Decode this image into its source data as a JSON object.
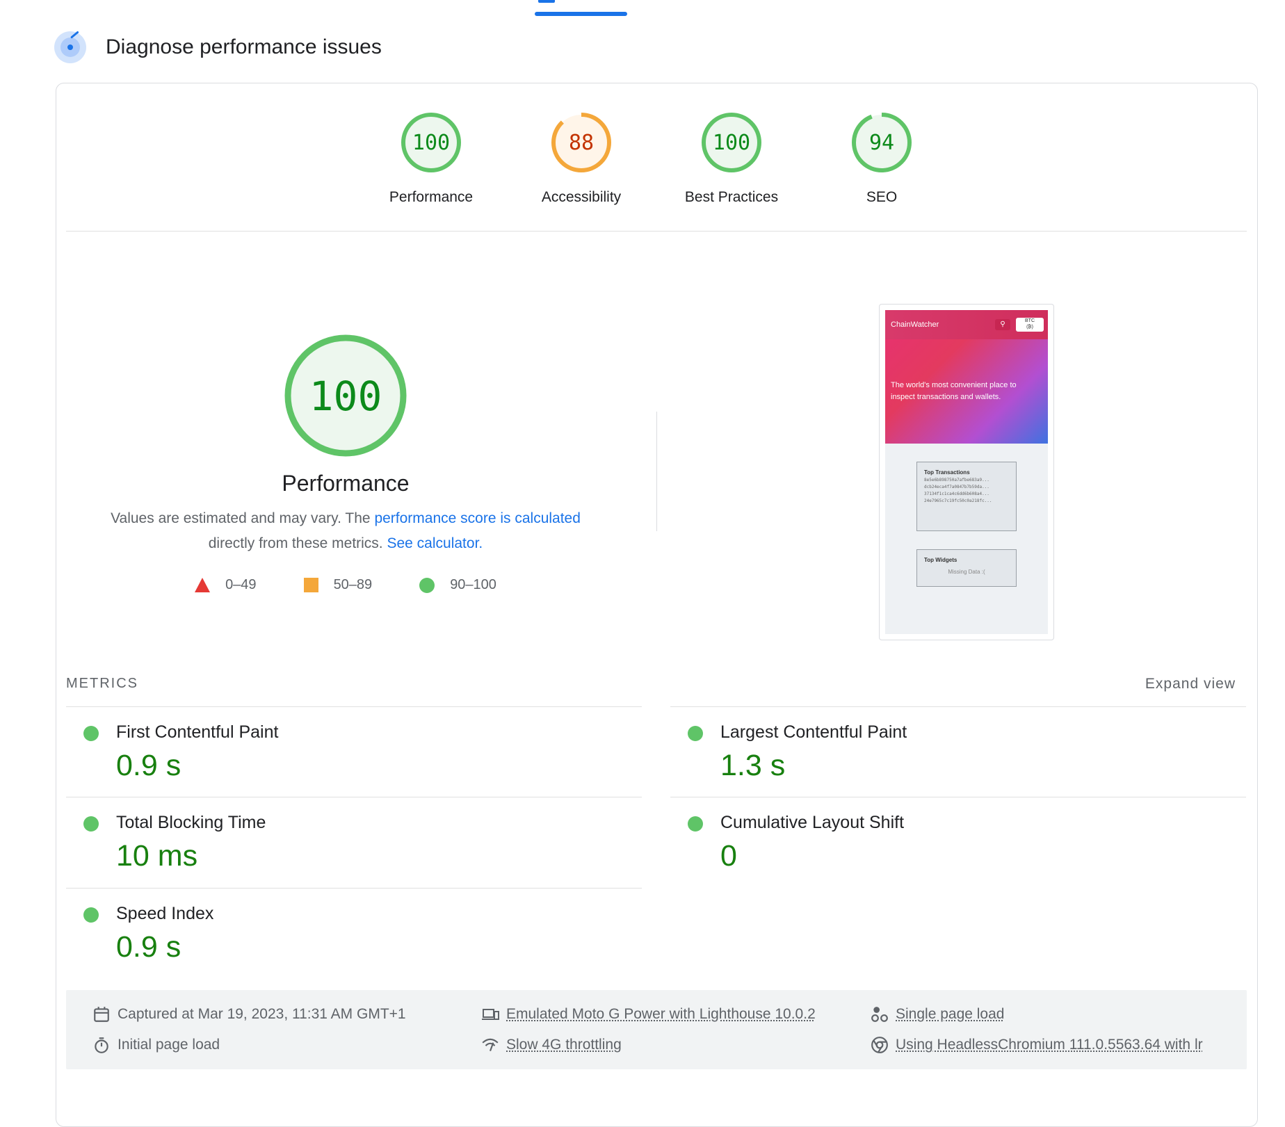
{
  "section": {
    "title": "Diagnose performance issues"
  },
  "gauges": [
    {
      "score": "100",
      "label": "Performance",
      "value": 100,
      "status": "pass"
    },
    {
      "score": "88",
      "label": "Accessibility",
      "value": 88,
      "status": "average"
    },
    {
      "score": "100",
      "label": "Best Practices",
      "value": 100,
      "status": "pass"
    },
    {
      "score": "94",
      "label": "SEO",
      "value": 94,
      "status": "pass"
    }
  ],
  "performance": {
    "score": "100",
    "value": 100,
    "title": "Performance",
    "desc_prefix": "Values are estimated and may vary. The ",
    "desc_link": "performance score is calculated",
    "desc_middle": " directly from these metrics. ",
    "desc_link2": "See calculator.",
    "legend": [
      {
        "range": "0–49",
        "shape": "triangle",
        "color": "#e53935"
      },
      {
        "range": "50–89",
        "shape": "square",
        "color": "#f4a73a"
      },
      {
        "range": "90–100",
        "shape": "circle",
        "color": "#5fc467"
      }
    ]
  },
  "screenshot": {
    "brand": "ChainWatcher",
    "currency_top": "BTC",
    "currency_bottom": "(₿)",
    "hero_text": "The world's most convenient place to inspect transactions and wallets.",
    "box1_title": "Top Transactions",
    "transactions": [
      "8e5e6b898750a7afbe683a9...",
      "dcb24eca4f7a0847b7b59da...",
      "37134f1c1ca4c6dd6b608a4...",
      "24e7965c7c19fc50c0a218fc..."
    ],
    "box2_title": "Top Widgets",
    "box2_text": "Missing Data :("
  },
  "metrics": {
    "title": "METRICS",
    "expand": "Expand view",
    "items": [
      {
        "name": "First Contentful Paint",
        "value": "0.9 s"
      },
      {
        "name": "Largest Contentful Paint",
        "value": "1.3 s"
      },
      {
        "name": "Total Blocking Time",
        "value": "10 ms"
      },
      {
        "name": "Cumulative Layout Shift",
        "value": "0"
      },
      {
        "name": "Speed Index",
        "value": "0.9 s"
      }
    ]
  },
  "environment": {
    "captured": "Captured at Mar 19, 2023, 11:31 AM GMT+1",
    "initial": "Initial page load",
    "device": "Emulated Moto G Power with Lighthouse 10.0.2",
    "throttling": "Slow 4G throttling",
    "single": "Single page load",
    "browser": "Using HeadlessChromium 111.0.5563.64 with lr"
  },
  "colors": {
    "pass": "#0c8a1a",
    "pass_ring": "#5fc467",
    "pass_fill": "#edf7ee",
    "average": "#c33300",
    "average_ring": "#f4a73a",
    "average_fill": "#fff5e9",
    "accent": "#1a73e8"
  }
}
